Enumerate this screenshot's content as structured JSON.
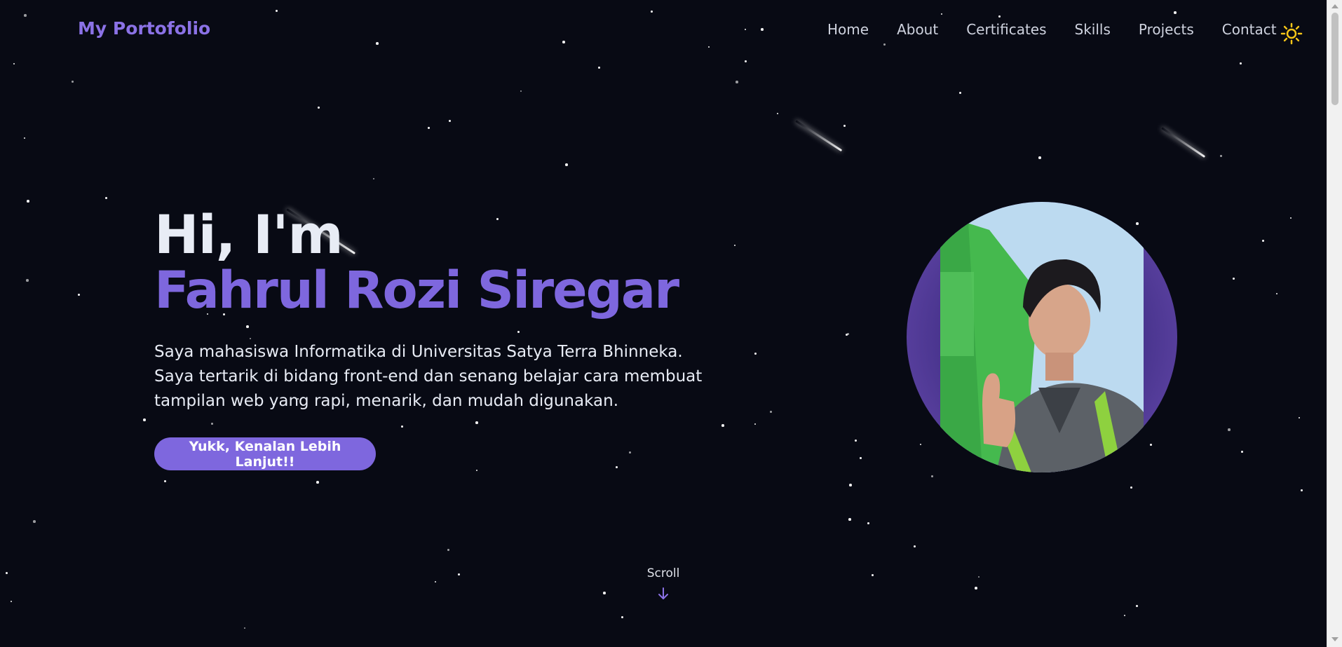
{
  "nav": {
    "brand": "My Portofolio",
    "links": [
      "Home",
      "About",
      "Certificates",
      "Skills",
      "Projects",
      "Contact"
    ],
    "theme_icon": "sun-icon"
  },
  "hero": {
    "greeting": "Hi, I'm",
    "name": "Fahrul Rozi Siregar",
    "description_lines": [
      "Saya mahasiswa Informatika di Universitas Satya Terra Bhinneka.",
      "Saya tertarik di bidang front-end dan senang belajar cara membuat",
      "tampilan web yang rapi, menarik, dan mudah digunakan."
    ],
    "cta": "Yukk, Kenalan Lebih Lanjut!!"
  },
  "scroll": {
    "label": "Scroll",
    "icon": "arrow-down-icon"
  },
  "colors": {
    "background": "#080a14",
    "accent": "#7e67de",
    "brand": "#8b72e6",
    "sun": "#f5c518"
  }
}
